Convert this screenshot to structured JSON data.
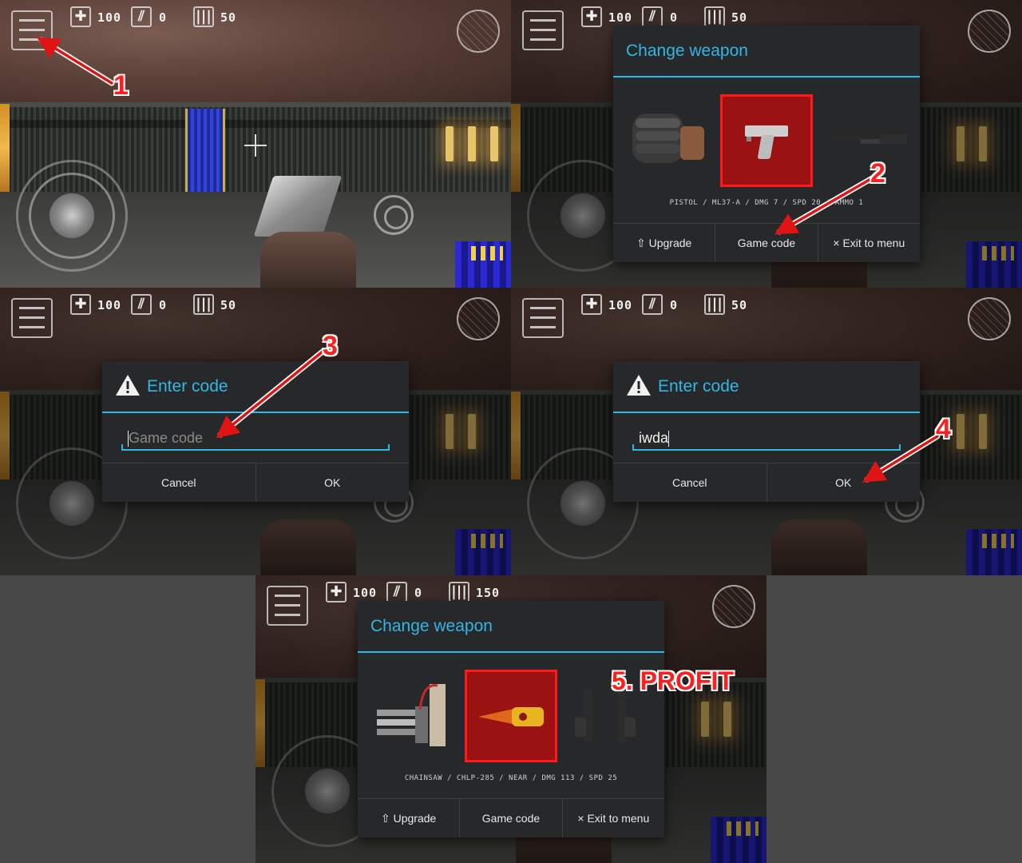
{
  "hud": {
    "health": "100",
    "armor": "0",
    "ammo": "50",
    "ammo_final": "150"
  },
  "panel1": {
    "step": "1"
  },
  "panel2": {
    "title": "Change weapon",
    "weapon_info": "PISTOL / ML37-A / DMG 7 / SPD 20 / AMMO 1",
    "buttons": {
      "upgrade": "⇧ Upgrade",
      "game_code": "Game code",
      "exit": "× Exit to menu"
    },
    "step": "2"
  },
  "panel3": {
    "title": "Enter code",
    "placeholder": "Game code",
    "buttons": {
      "cancel": "Cancel",
      "ok": "OK"
    },
    "step": "3"
  },
  "panel4": {
    "title": "Enter code",
    "value": "iwda",
    "buttons": {
      "cancel": "Cancel",
      "ok": "OK"
    },
    "step": "4"
  },
  "panel5": {
    "title": "Change weapon",
    "weapon_info": "CHAINSAW / CHLP-285 / NEAR / DMG 113 / SPD 25",
    "buttons": {
      "upgrade": "⇧ Upgrade",
      "game_code": "Game code",
      "exit": "× Exit to menu"
    },
    "profit": "5. PROFIT"
  },
  "icons": [
    "menu-icon",
    "health-icon",
    "armor-icon",
    "ammo-icon",
    "radar-icon",
    "joystick-icon",
    "fire-icon",
    "warning-icon",
    "fist-icon",
    "pistol-icon",
    "shotgun-icon",
    "minigun-icon",
    "chainsaw-icon",
    "dual-pistol-icon"
  ],
  "colors": {
    "accent": "#33b5e5",
    "highlight": "#ff1a1a",
    "dialog_bg": "#272829"
  }
}
